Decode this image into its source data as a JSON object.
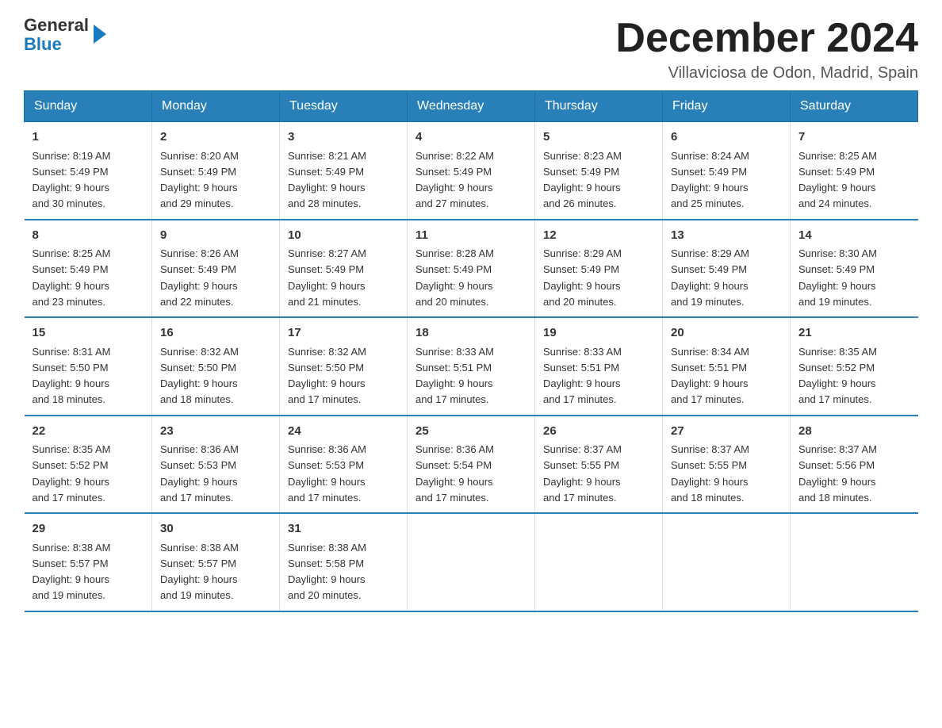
{
  "header": {
    "logo_general": "General",
    "logo_blue": "Blue",
    "month_title": "December 2024",
    "location": "Villaviciosa de Odon, Madrid, Spain"
  },
  "days_of_week": [
    "Sunday",
    "Monday",
    "Tuesday",
    "Wednesday",
    "Thursday",
    "Friday",
    "Saturday"
  ],
  "weeks": [
    [
      {
        "day": "1",
        "sunrise": "8:19 AM",
        "sunset": "5:49 PM",
        "daylight": "9 hours and 30 minutes."
      },
      {
        "day": "2",
        "sunrise": "8:20 AM",
        "sunset": "5:49 PM",
        "daylight": "9 hours and 29 minutes."
      },
      {
        "day": "3",
        "sunrise": "8:21 AM",
        "sunset": "5:49 PM",
        "daylight": "9 hours and 28 minutes."
      },
      {
        "day": "4",
        "sunrise": "8:22 AM",
        "sunset": "5:49 PM",
        "daylight": "9 hours and 27 minutes."
      },
      {
        "day": "5",
        "sunrise": "8:23 AM",
        "sunset": "5:49 PM",
        "daylight": "9 hours and 26 minutes."
      },
      {
        "day": "6",
        "sunrise": "8:24 AM",
        "sunset": "5:49 PM",
        "daylight": "9 hours and 25 minutes."
      },
      {
        "day": "7",
        "sunrise": "8:25 AM",
        "sunset": "5:49 PM",
        "daylight": "9 hours and 24 minutes."
      }
    ],
    [
      {
        "day": "8",
        "sunrise": "8:25 AM",
        "sunset": "5:49 PM",
        "daylight": "9 hours and 23 minutes."
      },
      {
        "day": "9",
        "sunrise": "8:26 AM",
        "sunset": "5:49 PM",
        "daylight": "9 hours and 22 minutes."
      },
      {
        "day": "10",
        "sunrise": "8:27 AM",
        "sunset": "5:49 PM",
        "daylight": "9 hours and 21 minutes."
      },
      {
        "day": "11",
        "sunrise": "8:28 AM",
        "sunset": "5:49 PM",
        "daylight": "9 hours and 20 minutes."
      },
      {
        "day": "12",
        "sunrise": "8:29 AM",
        "sunset": "5:49 PM",
        "daylight": "9 hours and 20 minutes."
      },
      {
        "day": "13",
        "sunrise": "8:29 AM",
        "sunset": "5:49 PM",
        "daylight": "9 hours and 19 minutes."
      },
      {
        "day": "14",
        "sunrise": "8:30 AM",
        "sunset": "5:49 PM",
        "daylight": "9 hours and 19 minutes."
      }
    ],
    [
      {
        "day": "15",
        "sunrise": "8:31 AM",
        "sunset": "5:50 PM",
        "daylight": "9 hours and 18 minutes."
      },
      {
        "day": "16",
        "sunrise": "8:32 AM",
        "sunset": "5:50 PM",
        "daylight": "9 hours and 18 minutes."
      },
      {
        "day": "17",
        "sunrise": "8:32 AM",
        "sunset": "5:50 PM",
        "daylight": "9 hours and 17 minutes."
      },
      {
        "day": "18",
        "sunrise": "8:33 AM",
        "sunset": "5:51 PM",
        "daylight": "9 hours and 17 minutes."
      },
      {
        "day": "19",
        "sunrise": "8:33 AM",
        "sunset": "5:51 PM",
        "daylight": "9 hours and 17 minutes."
      },
      {
        "day": "20",
        "sunrise": "8:34 AM",
        "sunset": "5:51 PM",
        "daylight": "9 hours and 17 minutes."
      },
      {
        "day": "21",
        "sunrise": "8:35 AM",
        "sunset": "5:52 PM",
        "daylight": "9 hours and 17 minutes."
      }
    ],
    [
      {
        "day": "22",
        "sunrise": "8:35 AM",
        "sunset": "5:52 PM",
        "daylight": "9 hours and 17 minutes."
      },
      {
        "day": "23",
        "sunrise": "8:36 AM",
        "sunset": "5:53 PM",
        "daylight": "9 hours and 17 minutes."
      },
      {
        "day": "24",
        "sunrise": "8:36 AM",
        "sunset": "5:53 PM",
        "daylight": "9 hours and 17 minutes."
      },
      {
        "day": "25",
        "sunrise": "8:36 AM",
        "sunset": "5:54 PM",
        "daylight": "9 hours and 17 minutes."
      },
      {
        "day": "26",
        "sunrise": "8:37 AM",
        "sunset": "5:55 PM",
        "daylight": "9 hours and 17 minutes."
      },
      {
        "day": "27",
        "sunrise": "8:37 AM",
        "sunset": "5:55 PM",
        "daylight": "9 hours and 18 minutes."
      },
      {
        "day": "28",
        "sunrise": "8:37 AM",
        "sunset": "5:56 PM",
        "daylight": "9 hours and 18 minutes."
      }
    ],
    [
      {
        "day": "29",
        "sunrise": "8:38 AM",
        "sunset": "5:57 PM",
        "daylight": "9 hours and 19 minutes."
      },
      {
        "day": "30",
        "sunrise": "8:38 AM",
        "sunset": "5:57 PM",
        "daylight": "9 hours and 19 minutes."
      },
      {
        "day": "31",
        "sunrise": "8:38 AM",
        "sunset": "5:58 PM",
        "daylight": "9 hours and 20 minutes."
      },
      null,
      null,
      null,
      null
    ]
  ],
  "sunrise_label": "Sunrise:",
  "sunset_label": "Sunset:",
  "daylight_label": "Daylight:"
}
